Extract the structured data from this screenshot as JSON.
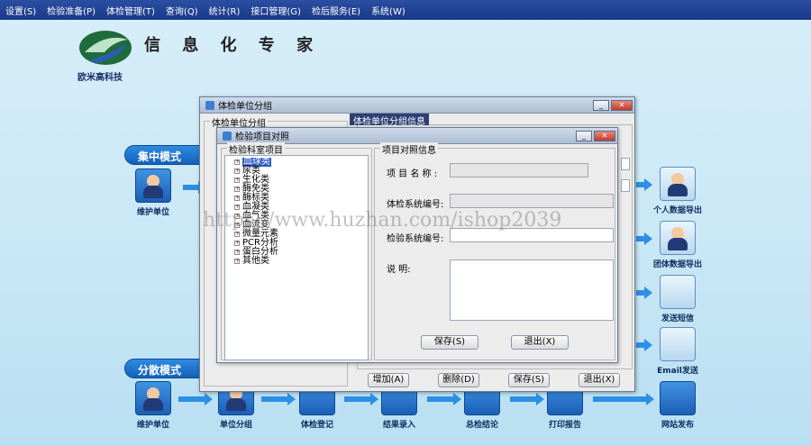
{
  "menu": [
    "设置(S)",
    "检验准备(P)",
    "体检管理(T)",
    "查询(Q)",
    "统计(R)",
    "接口管理(G)",
    "检后服务(E)",
    "系统(W)"
  ],
  "header": {
    "logo_text": "欧米高科技",
    "banner": "信 息 化 专 家"
  },
  "sections": {
    "centered": "集中模式",
    "distributed": "分散模式"
  },
  "flow_top": {
    "maintain_unit": "维护单位"
  },
  "flow_bottom": [
    "维护单位",
    "单位分组",
    "体检登记",
    "结果录入",
    "总检结论",
    "打印报告",
    "网站发布"
  ],
  "flow_right": [
    "个人数据导出",
    "团体数据导出",
    "发送短信",
    "Email发送"
  ],
  "outer_window": {
    "title": "体检单位分组",
    "group_title": "体检单位分组",
    "tab_label": "体检单位分组信息",
    "buttons": [
      "增加(A)",
      "删除(D)",
      "保存(S)",
      "退出(X)"
    ]
  },
  "inner_window": {
    "title": "检验项目对照",
    "tree_group_title": "检验科室项目",
    "tree_items": [
      "血球类",
      "尿类",
      "生化类",
      "酶免类",
      "酶标类",
      "血凝类",
      "血气类",
      "血流变",
      "微量元素",
      "PCR分析",
      "蛋白分析",
      "其他类"
    ],
    "detail_group_title": "项目对照信息",
    "labels": {
      "item_name": "项 目 名 称 :",
      "exam_code": "体检系统编号:",
      "lab_code": "检验系统编号:",
      "remark": "说         明:"
    },
    "buttons": {
      "save": "保存(S)",
      "exit": "退出(X)"
    }
  },
  "watermark": "https://www.huzhan.com/ishop2039"
}
